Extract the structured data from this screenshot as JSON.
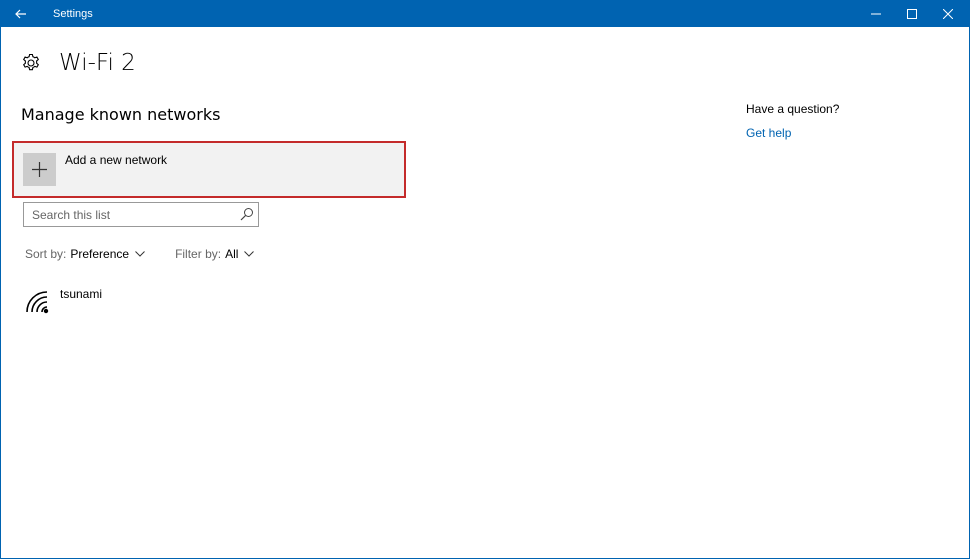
{
  "window": {
    "title": "Settings"
  },
  "header": {
    "title": "Wi-Fi 2"
  },
  "section": {
    "title": "Manage known networks"
  },
  "add_network": {
    "label": "Add a new network"
  },
  "search": {
    "placeholder": "Search this list",
    "value": ""
  },
  "sort": {
    "label": "Sort by:",
    "value": "Preference"
  },
  "filter": {
    "label": "Filter by:",
    "value": "All"
  },
  "networks": [
    {
      "name": "tsunami",
      "icon": "wifi-signal-icon"
    }
  ],
  "help": {
    "question": "Have a question?",
    "link": "Get help"
  },
  "colors": {
    "accent": "#0063b1",
    "highlight": "#c42b2b",
    "tile": "#cccccc",
    "panel": "#f2f2f2"
  }
}
